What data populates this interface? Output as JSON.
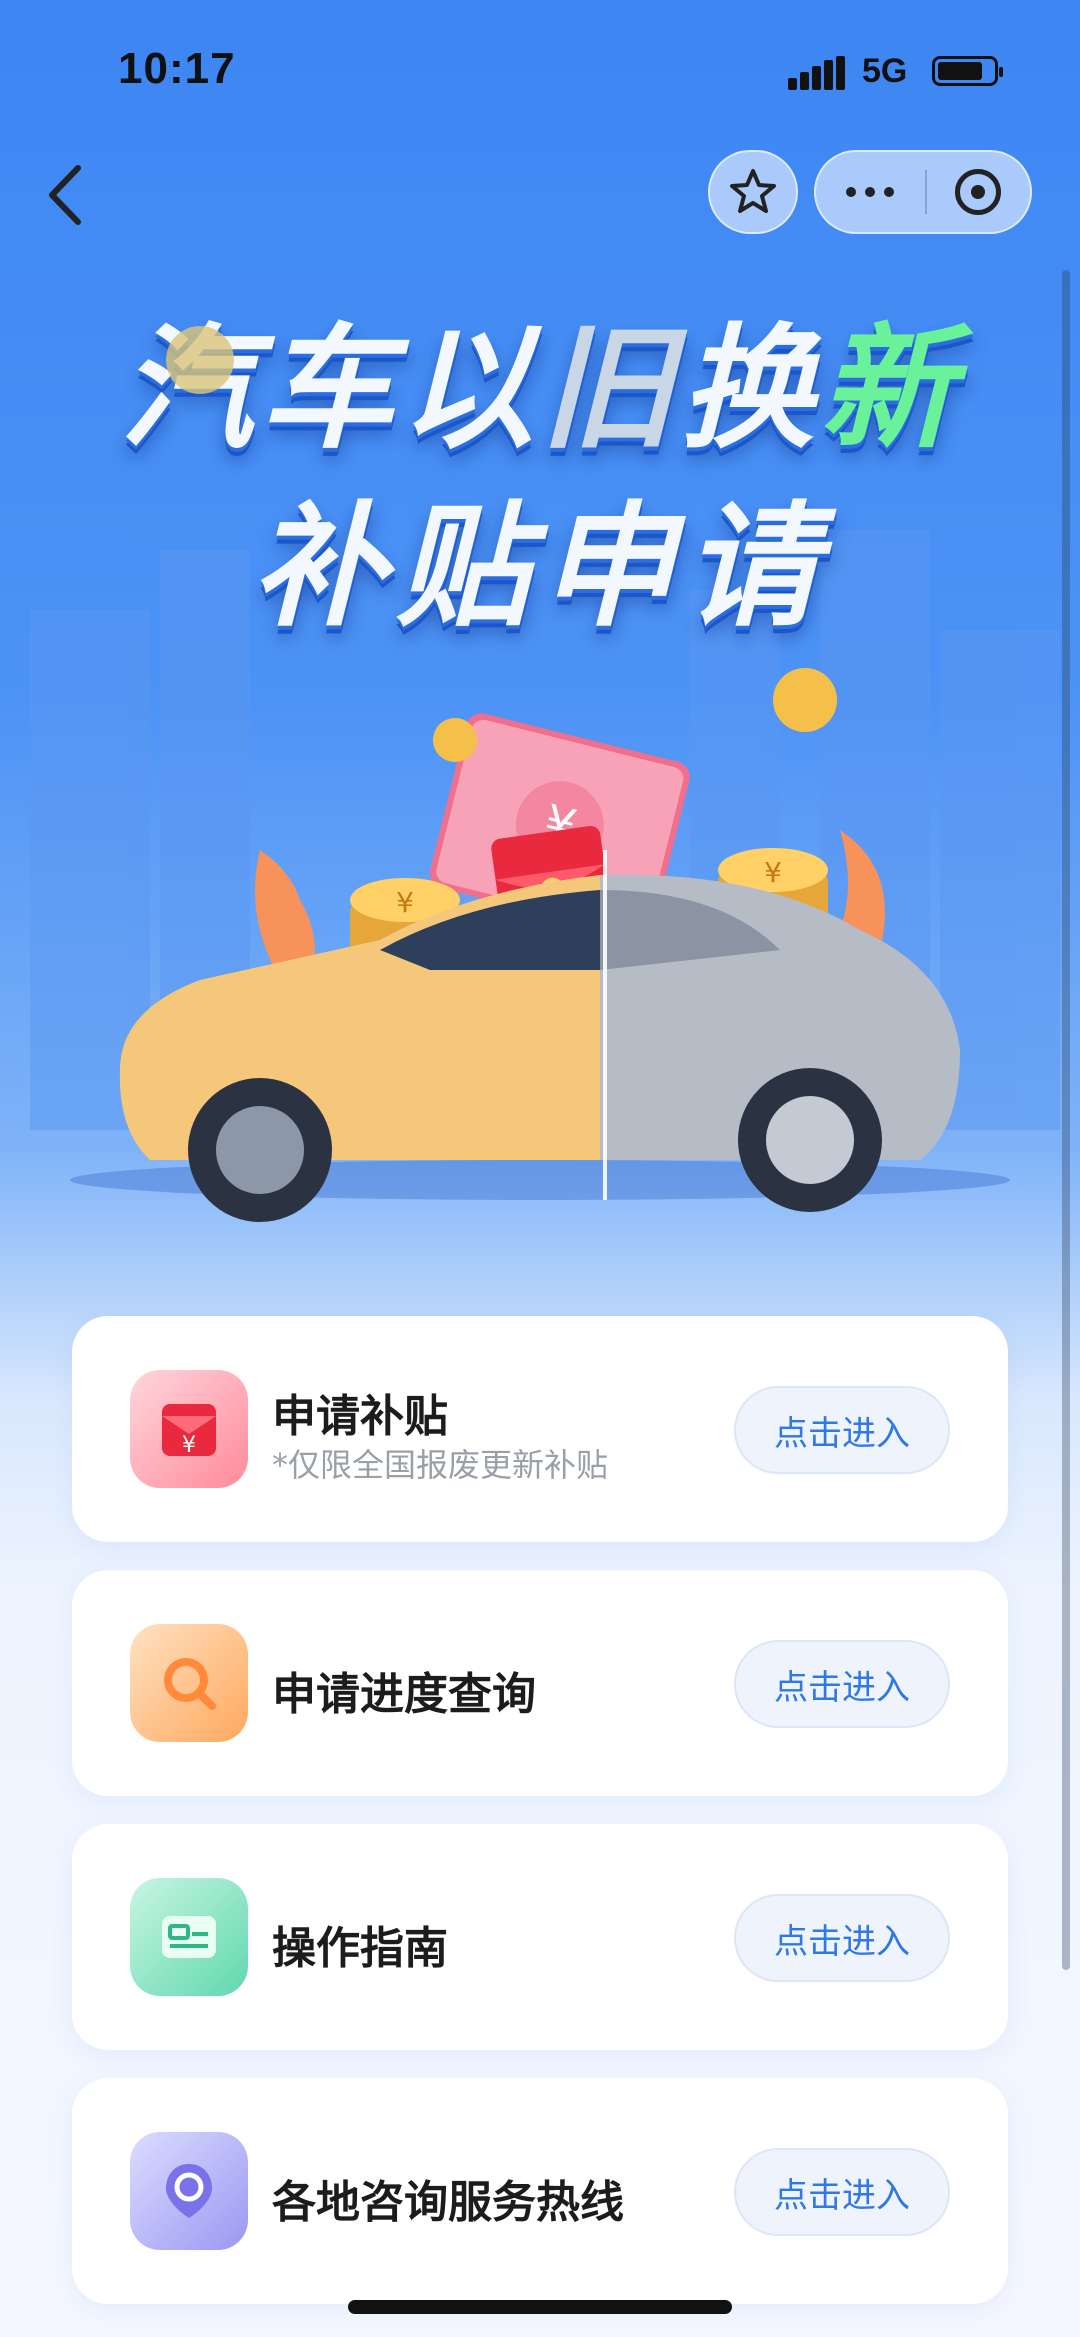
{
  "status_bar": {
    "time": "10:17",
    "network": "5G"
  },
  "hero": {
    "title_line1_a": "汽车以",
    "title_line1_b": "旧",
    "title_line1_c": "换",
    "title_line1_d": "新",
    "title_line2": "补贴申请"
  },
  "menu": [
    {
      "title": "申请补贴",
      "subtitle": "*仅限全国报废更新补贴",
      "button": "点击进入",
      "icon": "red-envelope-icon"
    },
    {
      "title": "申请进度查询",
      "subtitle": "",
      "button": "点击进入",
      "icon": "search-icon"
    },
    {
      "title": "操作指南",
      "subtitle": "",
      "button": "点击进入",
      "icon": "guide-card-icon"
    },
    {
      "title": "各地咨询服务热线",
      "subtitle": "",
      "button": "点击进入",
      "icon": "location-phone-icon"
    }
  ],
  "colors": {
    "accent_blue": "#3d86f3",
    "button_text": "#2f78e6",
    "title_green": "#6af29a"
  }
}
